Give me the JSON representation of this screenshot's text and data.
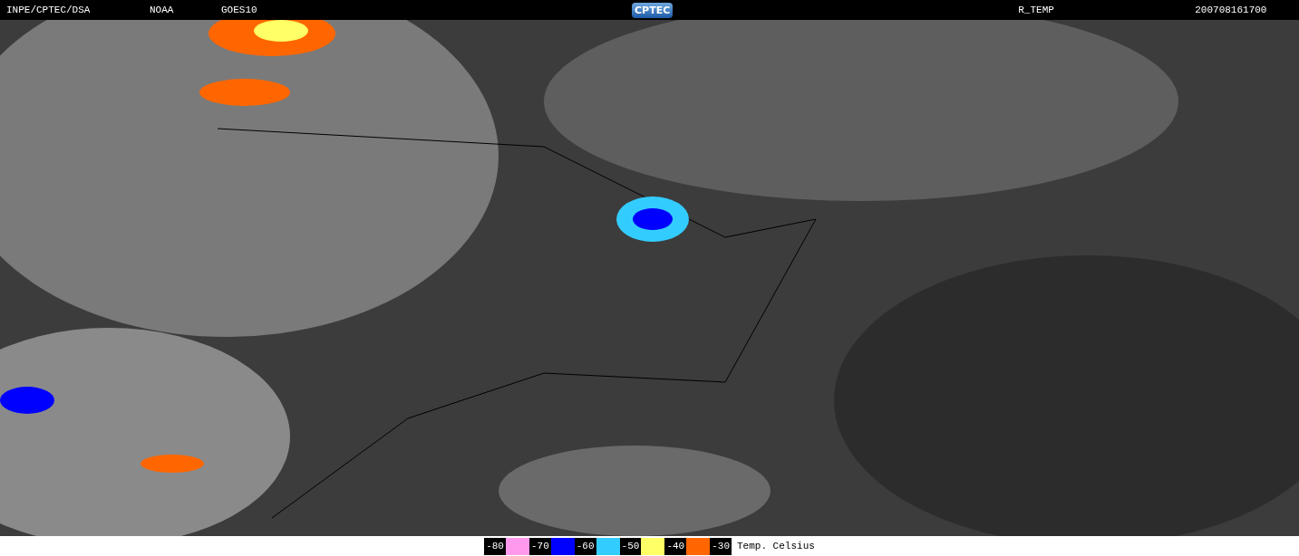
{
  "header": {
    "texts": [
      "INPE/CPTEC/DSA",
      "NOAA",
      "GOES10"
    ],
    "logo": "CPTEC",
    "product": "R_TEMP",
    "timestamp": "200708161700"
  },
  "legend": {
    "labels": [
      "-80",
      "-70",
      "-60",
      "-50",
      "-40",
      "-30"
    ],
    "swatches": [
      {
        "color": "#ff99ee"
      },
      {
        "color": "#0000ff"
      },
      {
        "color": "#33ccff"
      },
      {
        "color": "#ffff66"
      },
      {
        "color": "#ff6600"
      }
    ],
    "caption": "Temp. Celsius"
  }
}
